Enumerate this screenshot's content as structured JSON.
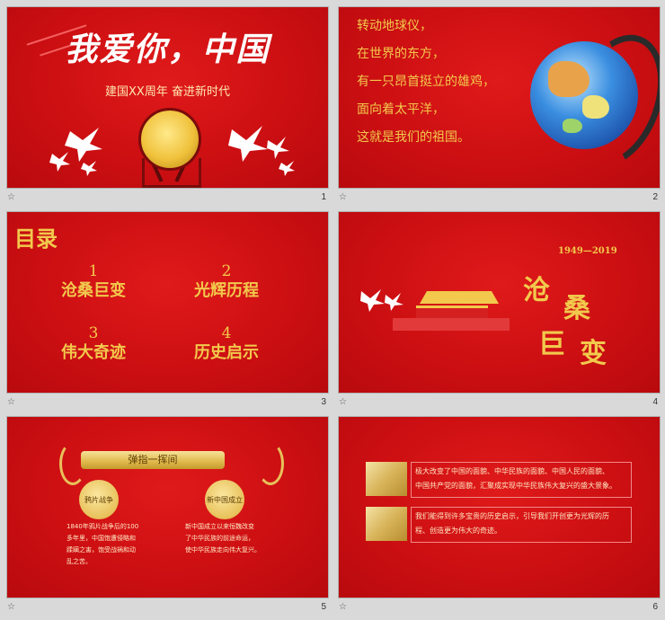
{
  "slides": [
    {
      "number": "1",
      "title": "我爱你，中国",
      "subtitle": "建国XX周年  奋进新时代"
    },
    {
      "number": "2",
      "lines": [
        "转动地球仪，",
        "在世界的东方，",
        "有一只昂首挺立的雄鸡，",
        "面向着太平洋，",
        "这就是我们的祖国。"
      ]
    },
    {
      "number": "3",
      "title": "目录",
      "items": [
        {
          "n": "1",
          "label": "沧桑巨变"
        },
        {
          "n": "2",
          "label": "光辉历程"
        },
        {
          "n": "3",
          "label": "伟大奇迹"
        },
        {
          "n": "4",
          "label": "历史启示"
        }
      ]
    },
    {
      "number": "4",
      "years": "1949—2019",
      "c1": "沧",
      "c2": "桑",
      "c3": "巨",
      "c4": "变"
    },
    {
      "number": "5",
      "banner": "弹指一挥间",
      "left_circle": "鸦片战争",
      "right_circle": "新中国成立",
      "left_text": [
        "1840年鸦片战争后的100",
        "多年里，中国饱遭侵略和",
        "蹂躏之害，饱受战祸和动",
        "乱之苦。"
      ],
      "right_text": [
        "新中国成立以来恒魏改变",
        "了中华民族的前途命运，",
        "使中华民族走向伟大复兴。"
      ]
    },
    {
      "number": "6",
      "box1": [
        "极大改变了中国的面貌、中华民族的面貌、中国人民的面貌、",
        "中国共产党的面貌，汇聚成实现中华民族伟大复兴的盛大景象。"
      ],
      "box2": [
        "我们能得到许多宝贵的历史启示，引导我们开创更为光辉的历",
        "程、创造更为伟大的奇迹。"
      ]
    }
  ],
  "footer_icon": "star-icon",
  "colors": {
    "slide_red": "#cc0f12",
    "gold": "#f2c94c",
    "background": "#d9d9d9"
  }
}
